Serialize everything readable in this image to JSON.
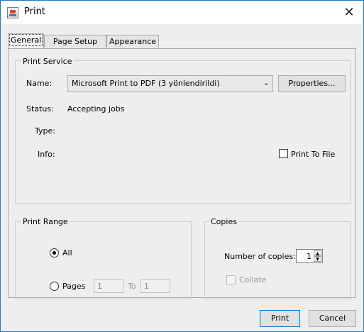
{
  "window": {
    "title": "Print",
    "icon": "java-print-icon",
    "close_glyph": "✕"
  },
  "tabs": [
    {
      "label": "General",
      "active": true
    },
    {
      "label": "Page Setup",
      "active": false
    },
    {
      "label": "Appearance",
      "active": false
    }
  ],
  "print_service": {
    "group_title": "Print Service",
    "name_label": "Name:",
    "printer": "Microsoft Print to PDF (3 yönlendirildi)",
    "properties_button": "Properties...",
    "status_label": "Status:",
    "status_value": "Accepting jobs",
    "type_label": "Type:",
    "type_value": "",
    "info_label": "Info:",
    "info_value": "",
    "print_to_file_label": "Print To File",
    "print_to_file_checked": false
  },
  "print_range": {
    "group_title": "Print Range",
    "all_label": "All",
    "all_selected": true,
    "pages_label": "Pages",
    "pages_from": "1",
    "to_label": "To",
    "pages_to": "1"
  },
  "copies": {
    "group_title": "Copies",
    "number_label": "Number of copies:",
    "number_value": "1",
    "collate_label": "Collate",
    "collate_checked": false,
    "collate_enabled": false
  },
  "buttons": {
    "print": "Print",
    "cancel": "Cancel"
  }
}
